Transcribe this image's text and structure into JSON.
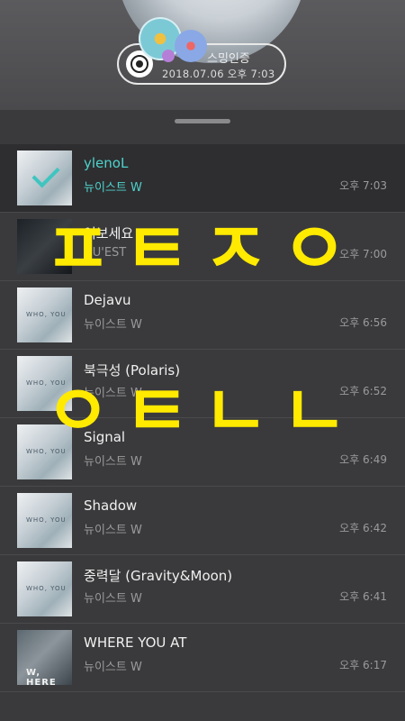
{
  "header": {
    "pill_title": "스밍인증",
    "pill_date": "2018.07.06 오후 7:03"
  },
  "tracks": [
    {
      "title": "ylenoL",
      "artist": "뉴이스트 W",
      "time": "오후 7:03",
      "cover": "NU'EST W - WHO, YOU"
    },
    {
      "title": "여보세요",
      "artist": "NU'EST",
      "time": "오후 7:00",
      "cover": "NU'EST"
    },
    {
      "title": "Dejavu",
      "artist": "뉴이스트 W",
      "time": "오후 6:56",
      "cover": "WHO, YOU"
    },
    {
      "title": "북극성 (Polaris)",
      "artist": "뉴이스트 W",
      "time": "오후 6:52",
      "cover": "WHO, YOU"
    },
    {
      "title": "Signal",
      "artist": "뉴이스트 W",
      "time": "오후 6:49",
      "cover": "WHO, YOU"
    },
    {
      "title": "Shadow",
      "artist": "뉴이스트 W",
      "time": "오후 6:42",
      "cover": "WHO, YOU"
    },
    {
      "title": "중력달 (Gravity&Moon)",
      "artist": "뉴이스트 W",
      "time": "오후 6:41",
      "cover": "WHO, YOU"
    },
    {
      "title": "WHERE YOU AT",
      "artist": "뉴이스트 W",
      "time": "오후 6:17",
      "cover": "W, HERE"
    }
  ],
  "overlay": {
    "top_text": "ㅍㅌㅈㅇ",
    "bottom_text": "ㅇㅌㄴㄴ"
  },
  "colors": {
    "accent": "#4ed2cc",
    "overlay": "#ffea00"
  }
}
